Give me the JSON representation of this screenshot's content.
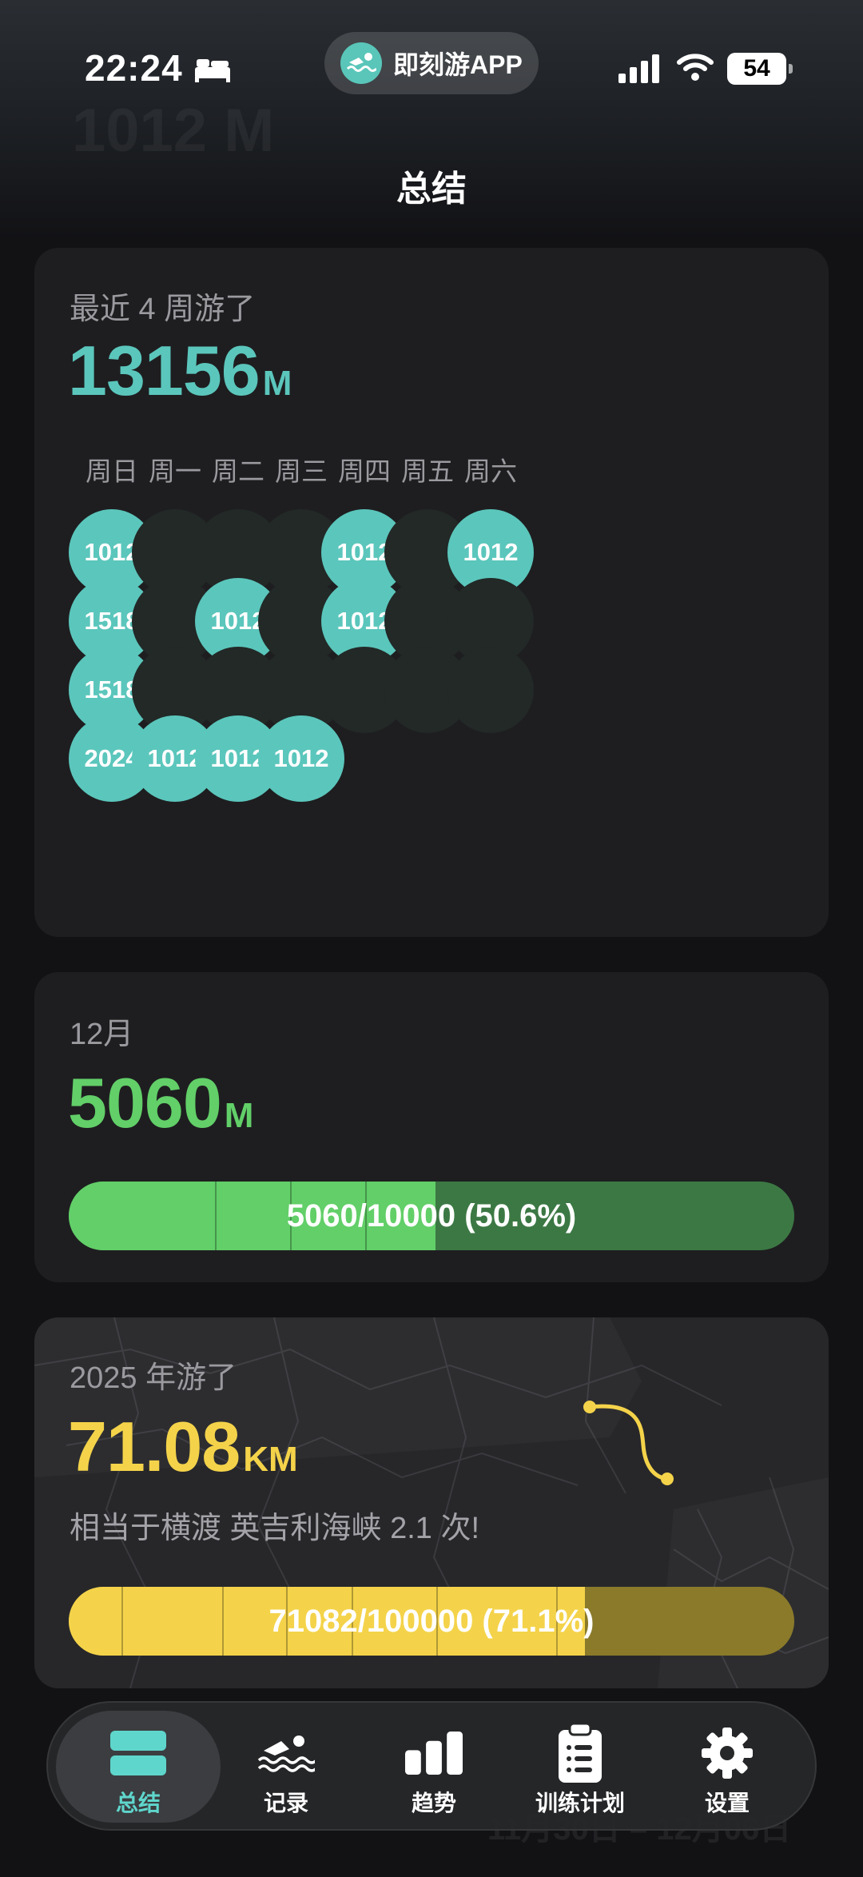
{
  "status": {
    "time": "22:24",
    "battery": "54"
  },
  "app_pill": {
    "name": "即刻游APP"
  },
  "header": {
    "title": "总结"
  },
  "week_card": {
    "label": "最近 4 周游了",
    "total": "13156",
    "unit": "M",
    "weekdays": [
      "周日",
      "周一",
      "周二",
      "周三",
      "周四",
      "周五",
      "周六"
    ],
    "rows": [
      [
        "1012",
        "",
        "",
        "",
        "1012",
        "",
        "1012"
      ],
      [
        "1518",
        "",
        "1012",
        "",
        "1012",
        "",
        ""
      ],
      [
        "1518",
        "",
        "",
        "",
        "",
        "",
        ""
      ],
      [
        "2024",
        "1012",
        "1012",
        "1012"
      ]
    ]
  },
  "month_card": {
    "label": "12月",
    "total": "5060",
    "unit": "M",
    "progress_text": "5060/10000 (50.6%)",
    "progress": 0.506
  },
  "year_card": {
    "label": "2025 年游了",
    "total": "71.08",
    "unit": "KM",
    "subtitle": "相当于横渡 英吉利海峡 2.1 次!",
    "progress_text": "71082/100000 (71.1%)",
    "progress": 0.711
  },
  "tabs": [
    {
      "label": "总结",
      "icon": "summary-icon",
      "active": true
    },
    {
      "label": "记录",
      "icon": "swimmer-icon",
      "active": false
    },
    {
      "label": "趋势",
      "icon": "bar-chart-icon",
      "active": false
    },
    {
      "label": "训练计划",
      "icon": "clipboard-icon",
      "active": false
    },
    {
      "label": "设置",
      "icon": "gear-icon",
      "active": false
    }
  ],
  "colors": {
    "teal": "#5bc6bc",
    "green": "#62cf68",
    "yellow": "#f4d34a",
    "active_tab": "#5fd6cc"
  }
}
